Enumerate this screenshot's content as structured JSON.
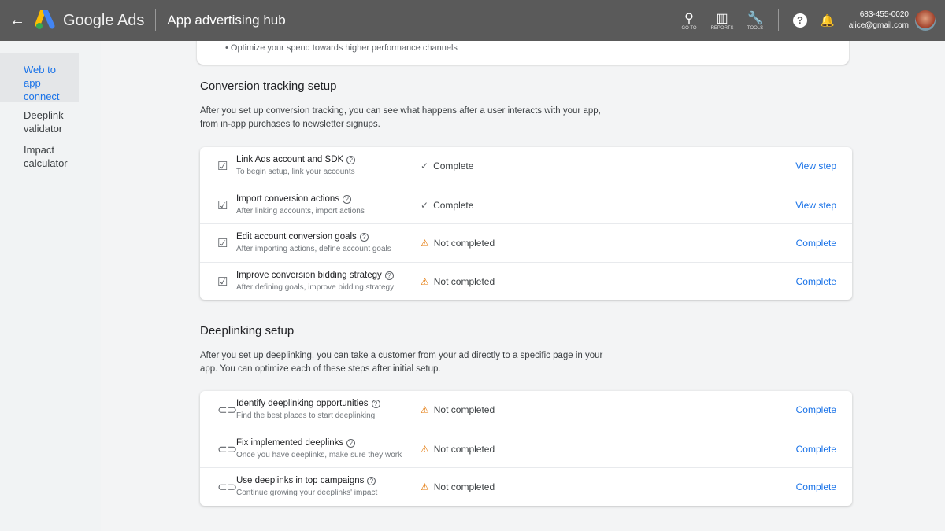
{
  "header": {
    "back_icon": "arrow-left-icon",
    "brand": "Google Ads",
    "title": "App advertising hub",
    "tools": [
      {
        "icon": "search-icon",
        "glyph": "⚲",
        "label": "GO TO"
      },
      {
        "icon": "reports-icon",
        "glyph": "▥",
        "label": "REPORTS"
      },
      {
        "icon": "wrench-icon",
        "glyph": "🔧",
        "label": "TOOLS"
      }
    ],
    "help_icon": "help-icon",
    "bell_icon": "bell-icon",
    "account_id": "683-455-0020",
    "email": "alice@gmail.com"
  },
  "sidebar": {
    "items": [
      {
        "label": "Web to app connect",
        "active": true
      },
      {
        "label": "Deeplink validator"
      },
      {
        "label": "Impact calculator"
      }
    ]
  },
  "top_card": {
    "text": "• Optimize your spend towards higher performance channels"
  },
  "conversion": {
    "title": "Conversion tracking setup",
    "desc": "After you set up conversion tracking, you can see what happens after a user interacts with your app, from in-app purchases to newsletter signups.",
    "rows": [
      {
        "title": "Link Ads account and SDK",
        "sub": "To begin setup, link your accounts",
        "status": "Complete",
        "done": true,
        "action": "View step"
      },
      {
        "title": "Import conversion actions",
        "sub": "After linking accounts, import actions",
        "status": "Complete",
        "done": true,
        "action": "View step"
      },
      {
        "title": "Edit account conversion goals",
        "sub": "After importing actions, define account goals",
        "status": "Not completed",
        "done": false,
        "action": "Complete"
      },
      {
        "title": "Improve conversion bidding strategy",
        "sub": "After defining goals, improve bidding strategy",
        "status": "Not completed",
        "done": false,
        "action": "Complete"
      }
    ]
  },
  "deeplinking": {
    "title": "Deeplinking setup",
    "desc": "After you set up deeplinking, you can take a customer from your ad directly to a specific page in your app. You can optimize each of these steps after initial setup.",
    "rows": [
      {
        "title": "Identify deeplinking opportunities",
        "sub": "Find the best places to start deeplinking",
        "status": "Not completed",
        "done": false,
        "action": "Complete"
      },
      {
        "title": "Fix implemented deeplinks",
        "sub": "Once you have deeplinks, make sure they work",
        "status": "Not completed",
        "done": false,
        "action": "Complete"
      },
      {
        "title": "Use deeplinks in top campaigns",
        "sub": "Continue growing your deeplinks' impact",
        "status": "Not completed",
        "done": false,
        "action": "Complete"
      }
    ]
  },
  "colors": {
    "header": "#5a5a5a",
    "link": "#1a73e8",
    "warning": "#e37400"
  }
}
